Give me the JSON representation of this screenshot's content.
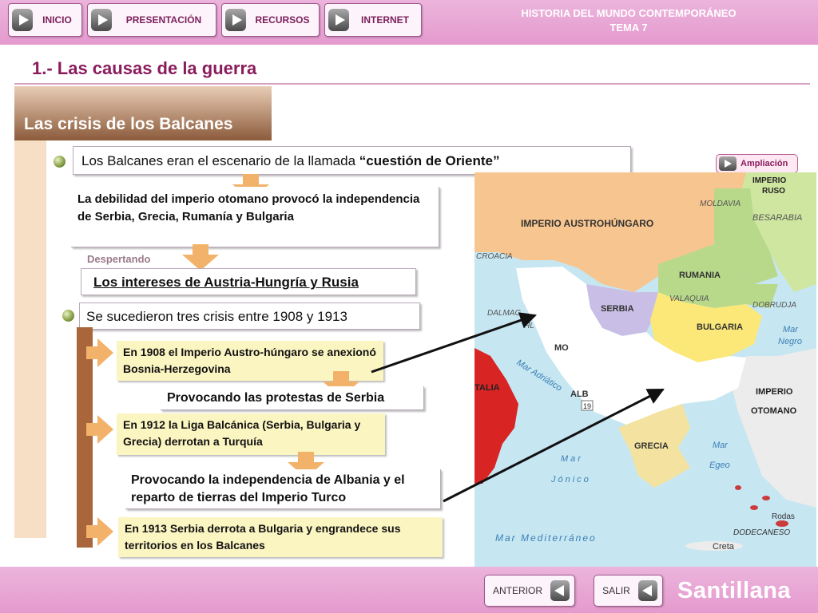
{
  "nav": {
    "inicio": "INICIO",
    "presentacion": "PRESENTACIÓN",
    "recursos": "RECURSOS",
    "internet": "INTERNET",
    "course_line1": "HISTORIA DEL MUNDO CONTEMPORÁNEO",
    "course_line2": "TEMA 7"
  },
  "slide": {
    "title": "1.- Las causas de la guerra",
    "section_tab": "Las crisis de los Balcanes"
  },
  "content": {
    "point1_text": "Los Balcanes eran el escenario de la llamada ",
    "point1_bold": "“cuestión de Oriente”",
    "debilidad": "La debilidad del imperio otomano provocó la independencia de Serbia, Grecia, Rumanía y Bulgaria",
    "despertando": "Despertando",
    "intereses": "Los intereses de Austria-Hungría y Rusia",
    "point2": "Se sucedieron tres crisis entre 1908 y 1913",
    "crisis_1908": "En 1908 el Imperio Austro-húngaro se anexionó Bosnia-Herzegovina",
    "protestas": "Provocando las protestas de Serbia",
    "crisis_1912": "En 1912 la Liga Balcánica (Serbia, Bulgaria y Grecia) derrotan a Turquía",
    "independencia": "Provocando la independencia de Albania y el reparto de tierras del Imperio Turco",
    "crisis_1913": "En 1913 Serbia derrota a Bulgaria y engrandece sus territorios en los Balcanes"
  },
  "map": {
    "button": "Ampliación",
    "labels": {
      "imperio_ruso": "IMPERIO RUSO",
      "moldavia": "MOLDAVIA",
      "besarabia": "BESARABIA",
      "imperio_austro": "IMPERIO AUSTROHÚNGARO",
      "croacia": "CROACIA",
      "rumania": "RUMANIA",
      "valaquia": "VALAQUIA",
      "dobrudja": "DOBRUDJA",
      "serbia": "SERBIA",
      "bulgaria": "BULGARIA",
      "dalmac": "DALMAC",
      "mar_negro": "Mar Negro",
      "mo": "MO",
      "hl": "HL",
      "adriatico": "Mar Adriático",
      "italia": "TALIA",
      "alb": "ALB",
      "num19": "19",
      "imperio_otomano": "IMPERIO OTOMANO",
      "grecia": "GRECIA",
      "mar_egeo": "Mar Egeo",
      "mar_jonico": "Mar Jónico",
      "rodas": "Rodas",
      "dodecaneso": "DODECANESO",
      "mar_med": "Mar Mediterráneo",
      "creta": "Creta"
    }
  },
  "footer": {
    "anterior": "ANTERIOR",
    "salir": "SALIR",
    "brand": "Santillana"
  }
}
